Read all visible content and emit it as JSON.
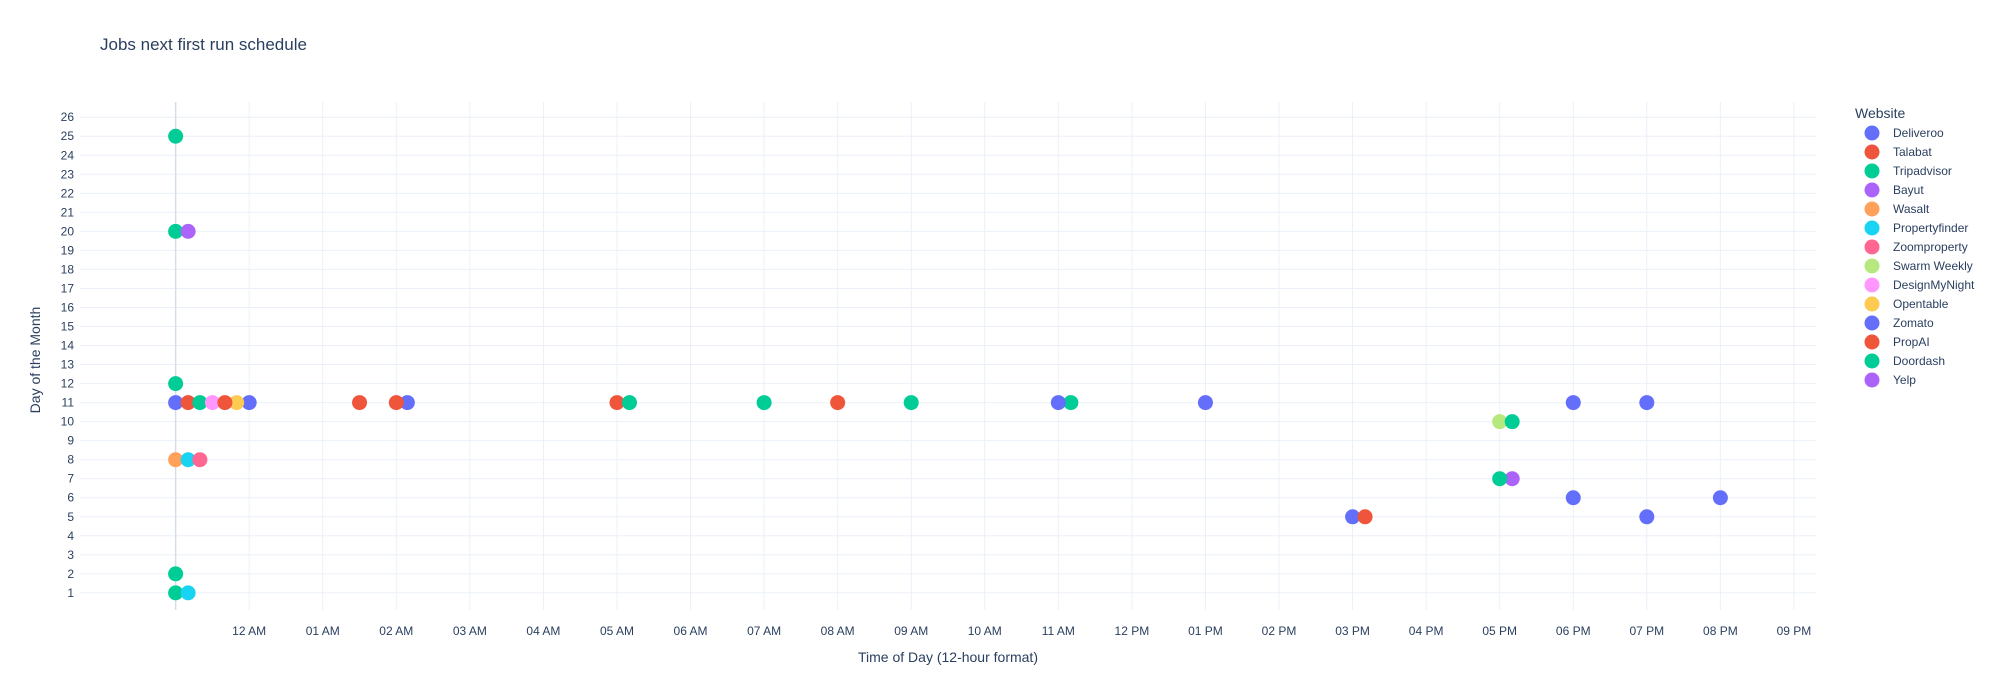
{
  "chart_data": {
    "type": "scatter",
    "title": "Jobs next first run schedule",
    "xlabel": "Time of Day (12-hour format)",
    "ylabel": "Day of the Month",
    "x_unit": "hour",
    "x_tick_values": [
      1,
      2,
      3,
      4,
      5,
      6,
      7,
      8,
      9,
      10,
      11,
      12,
      13,
      14,
      15,
      16,
      17,
      18,
      19,
      20,
      21,
      22
    ],
    "x_tick_labels": [
      "12 AM",
      "01 AM",
      "02 AM",
      "03 AM",
      "04 AM",
      "05 AM",
      "06 AM",
      "07 AM",
      "08 AM",
      "09 AM",
      "10 AM",
      "11 AM",
      "12 PM",
      "01 PM",
      "02 PM",
      "03 PM",
      "04 PM",
      "05 PM",
      "06 PM",
      "07 PM",
      "08 PM",
      "09 PM"
    ],
    "xlim": [
      -1.3,
      22.3
    ],
    "y_ticks": [
      1,
      2,
      3,
      4,
      5,
      6,
      7,
      8,
      9,
      10,
      11,
      12,
      13,
      14,
      15,
      16,
      17,
      18,
      19,
      20,
      21,
      22,
      23,
      24,
      25,
      26
    ],
    "ylim": [
      0.1,
      26.8
    ],
    "grid": true,
    "legend_title": "Website",
    "legend_position": "right",
    "marker": "circle",
    "series": [
      {
        "name": "Deliveroo",
        "color": "#636efa",
        "x": [
          0.0,
          1.0,
          3.15,
          14.0,
          16.0,
          19.0,
          19.0,
          20.0
        ],
        "y": [
          11,
          11,
          11,
          11,
          5,
          11,
          6,
          11
        ]
      },
      {
        "name": "Talabat",
        "color": "#ef553b",
        "x": [
          0.17,
          2.5,
          3.0,
          6.0,
          16.17
        ],
        "y": [
          11,
          11,
          11,
          11,
          5
        ]
      },
      {
        "name": "Tripadvisor",
        "color": "#00cc96",
        "x": [
          0.0,
          0.0,
          0.0,
          0.0,
          0.33,
          6.17,
          8.0,
          10.0,
          12.17
        ],
        "y": [
          25,
          20,
          12,
          1,
          11,
          11,
          11,
          11,
          11
        ]
      },
      {
        "name": "Bayut",
        "color": "#ab63fa",
        "x": [
          0.17,
          18.17
        ],
        "y": [
          20,
          7
        ]
      },
      {
        "name": "Wasalt",
        "color": "#ffa15a",
        "x": [
          0.0
        ],
        "y": [
          8
        ]
      },
      {
        "name": "Propertyfinder",
        "color": "#19d3f3",
        "x": [
          0.17,
          0.17
        ],
        "y": [
          8,
          1
        ]
      },
      {
        "name": "Zoomproperty",
        "color": "#ff6692",
        "x": [
          0.33
        ],
        "y": [
          8
        ]
      },
      {
        "name": "Swarm Weekly",
        "color": "#b6e880",
        "x": [
          18.0
        ],
        "y": [
          10
        ]
      },
      {
        "name": "DesignMyNight",
        "color": "#ff97ff",
        "x": [
          0.5
        ],
        "y": [
          11
        ]
      },
      {
        "name": "Opentable",
        "color": "#fecb52",
        "x": [
          0.83
        ],
        "y": [
          11
        ]
      },
      {
        "name": "Zomato",
        "color": "#636efa",
        "x": [
          12.0,
          20.0,
          21.0
        ],
        "y": [
          11,
          5,
          6
        ]
      },
      {
        "name": "PropAI",
        "color": "#ef553b",
        "x": [
          0.67,
          9.0
        ],
        "y": [
          11,
          11
        ]
      },
      {
        "name": "Doordash",
        "color": "#00cc96",
        "x": [
          0.0,
          18.17,
          18.0
        ],
        "y": [
          2,
          10,
          7
        ]
      },
      {
        "name": "Yelp",
        "color": "#ab63fa",
        "x": [],
        "y": []
      }
    ]
  }
}
